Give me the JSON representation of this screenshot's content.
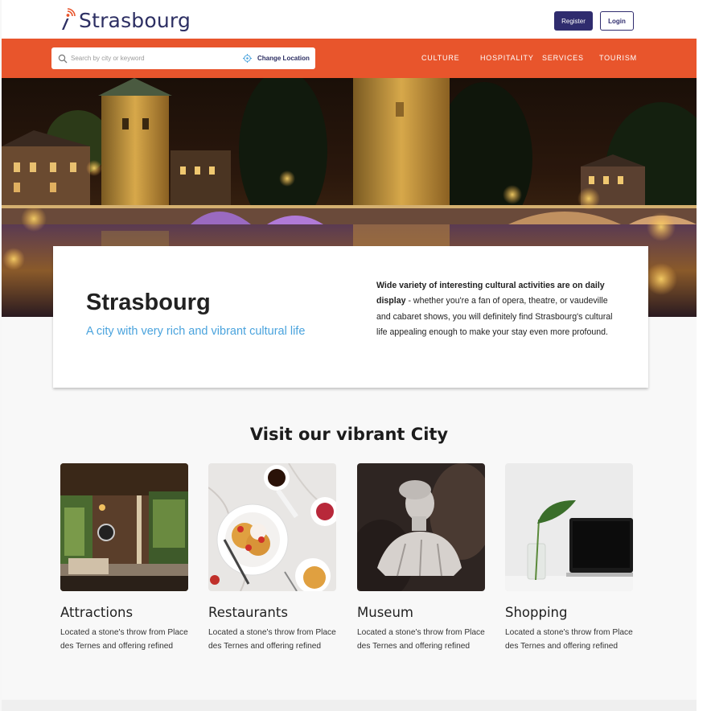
{
  "header": {
    "logo_text": "Strasbourg",
    "register_label": "Register",
    "login_label": "Login"
  },
  "navbar": {
    "search_placeholder": "Search by city or keyword",
    "change_location_label": "Change Location",
    "items": [
      {
        "label": "CULTURE"
      },
      {
        "label": "HOSPITALITY"
      },
      {
        "label": "SERVICES"
      },
      {
        "label": "TOURISM"
      }
    ]
  },
  "info": {
    "title": "Strasbourg",
    "subtitle": "A city with very rich and vibrant cultural life",
    "text_bold": "Wide variety of interesting cultural activities are on daily display",
    "text_rest": " - whether you're a fan of opera, theatre, or vaudeville and cabaret shows, you will definitely find Strasbourg's cultural life appealing enough to make your stay even more profound."
  },
  "section": {
    "title": "Visit our vibrant City",
    "cards": [
      {
        "title": "Attractions",
        "description": "Located a stone's throw from Place des Ternes and offering refined"
      },
      {
        "title": "Restaurants",
        "description": "Located a stone's throw from Place des Ternes and offering refined"
      },
      {
        "title": "Museum",
        "description": "Located a stone's throw from Place des Ternes and offering refined"
      },
      {
        "title": "Shopping",
        "description": "Located a stone's throw from Place des Ternes and offering refined"
      }
    ]
  },
  "colors": {
    "brand": "#2d2f63",
    "accent": "#e8552c",
    "subtitle": "#4aa3dd"
  }
}
